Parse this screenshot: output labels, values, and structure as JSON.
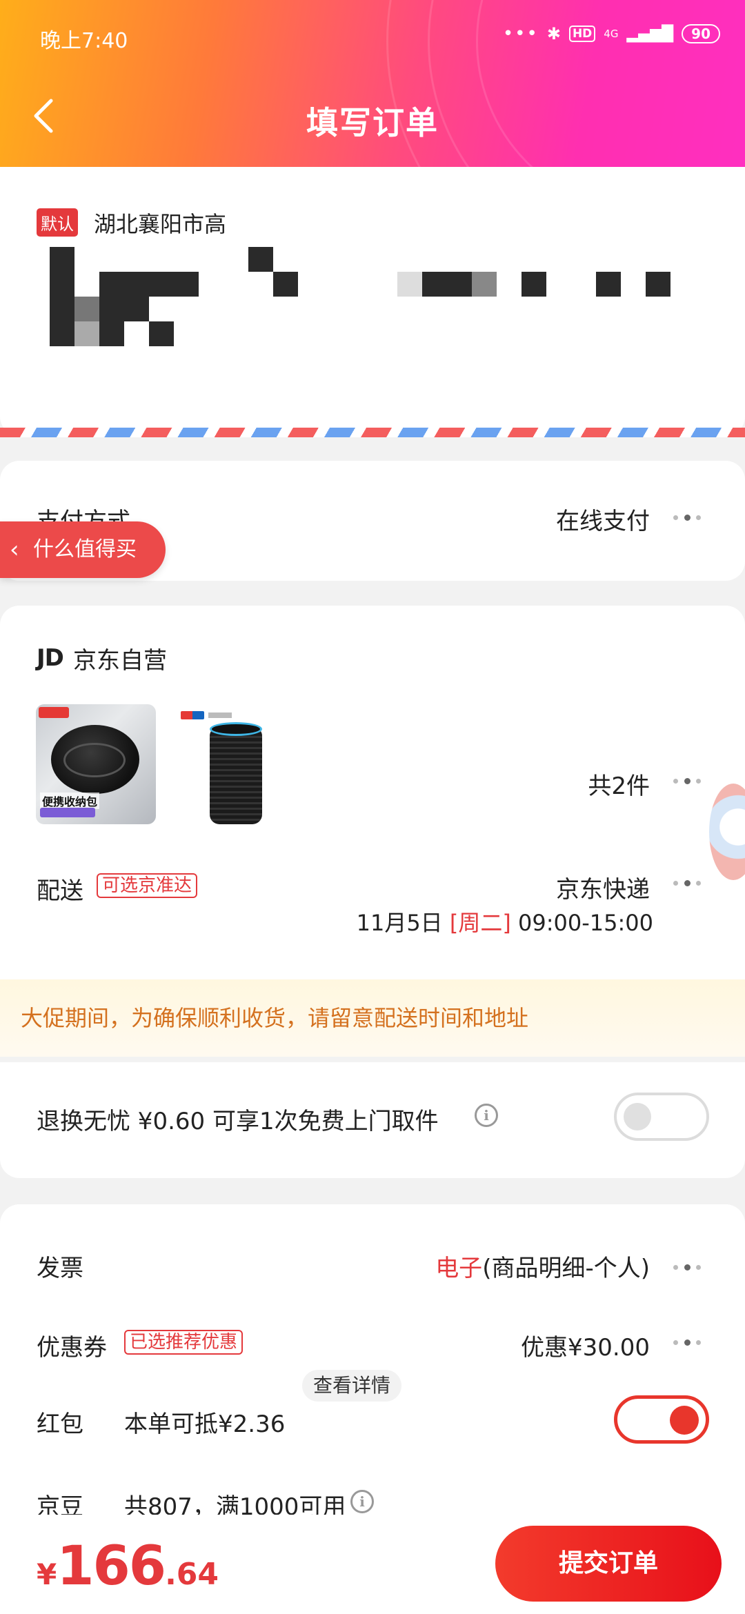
{
  "status_bar": {
    "time": "晚上7:40",
    "dots": "•••",
    "bluetooth": "✱",
    "hd": "HD",
    "network": "4G",
    "signal": "▂▄▆█",
    "battery": "90"
  },
  "header": {
    "title": "填写订单",
    "back_icon": "chevron-left-icon"
  },
  "address": {
    "default_badge": "默认",
    "line1": "湖北襄阳市高"
  },
  "payment": {
    "label": "支付方式",
    "value": "在线支付"
  },
  "floating_tag": {
    "label": "什么值得买"
  },
  "shop": {
    "logo": "JD",
    "name": "京东自营",
    "product1_caption": "便携收纳包",
    "item_count": "共2件"
  },
  "delivery": {
    "label": "配送",
    "tag": "可选京准达",
    "method": "京东快递",
    "date": "11月5日",
    "weekday": "[周二]",
    "time_range": "09:00-15:00"
  },
  "notice": {
    "text": "大促期间，为确保顺利收货，请留意配送时间和地址"
  },
  "return_service": {
    "text": "退换无忧 ¥0.60  可享1次免费上门取件",
    "enabled": false
  },
  "invoice": {
    "label": "发票",
    "value_highlight": "电子",
    "value_rest": "(商品明细-个人)"
  },
  "coupon": {
    "label": "优惠券",
    "tag": "已选推荐优惠",
    "value": "优惠¥30.00"
  },
  "red_packet": {
    "label": "红包",
    "text": "本单可抵¥2.36",
    "detail_button": "查看详情",
    "enabled": true
  },
  "jingdou": {
    "label": "京豆",
    "text": "共807，满1000可用"
  },
  "footer": {
    "currency": "¥",
    "price_int": "166",
    "price_dec": ".64",
    "submit": "提交订单"
  },
  "colors": {
    "accent_red": "#e4393c",
    "notice_text": "#d4711f",
    "header_gradient_start": "#ffae1a",
    "header_gradient_end": "#ff2fc0"
  }
}
